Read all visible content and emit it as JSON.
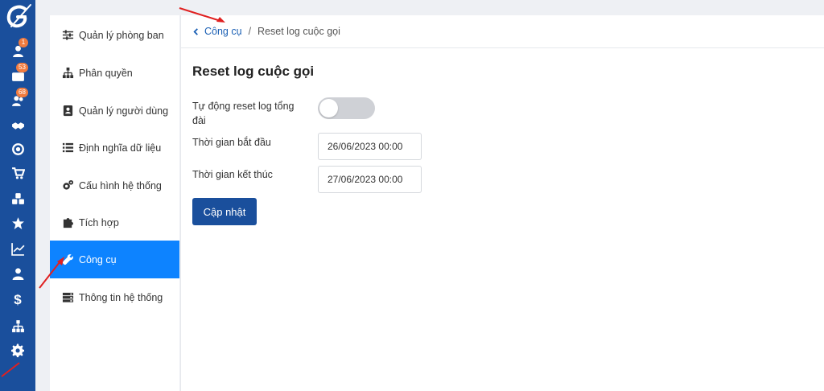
{
  "rail": {
    "items": [
      {
        "icon": "user-icon",
        "badge": "1"
      },
      {
        "icon": "contact-card-icon",
        "badge": "53"
      },
      {
        "icon": "users-icon",
        "badge": "68"
      },
      {
        "icon": "handshake-icon",
        "badge": ""
      },
      {
        "icon": "target-icon",
        "badge": ""
      },
      {
        "icon": "cart-icon",
        "badge": ""
      },
      {
        "icon": "cubes-icon",
        "badge": ""
      },
      {
        "icon": "star-icon",
        "badge": ""
      },
      {
        "icon": "chart-line-icon",
        "badge": ""
      },
      {
        "icon": "user-tie-icon",
        "badge": ""
      },
      {
        "icon": "dollar-icon",
        "badge": ""
      },
      {
        "icon": "sitemap-icon",
        "badge": ""
      },
      {
        "icon": "gear-icon",
        "badge": ""
      }
    ]
  },
  "menu": {
    "items": [
      {
        "label": "Quản lý phòng ban",
        "icon": "sliders-icon"
      },
      {
        "label": "Phân quyền",
        "icon": "sitemap-icon"
      },
      {
        "label": "Quản lý người dùng",
        "icon": "address-book-icon"
      },
      {
        "label": "Định nghĩa dữ liệu",
        "icon": "list-icon"
      },
      {
        "label": "Cấu hình hệ thống",
        "icon": "cogs-icon"
      },
      {
        "label": "Tích hợp",
        "icon": "puzzle-icon"
      },
      {
        "label": "Công cụ",
        "icon": "wrench-icon",
        "active": true
      },
      {
        "label": "Thông tin hệ thống",
        "icon": "server-icon"
      }
    ]
  },
  "breadcrumb": {
    "back_label": "Công cụ",
    "separator": "/",
    "current": "Reset log cuộc gọi"
  },
  "page": {
    "title": "Reset log cuộc gọi",
    "auto_reset_label": "Tự động reset log tổng đài",
    "auto_reset_enabled": false,
    "start_label": "Thời gian bắt đầu",
    "start_value": "26/06/2023 00:00",
    "end_label": "Thời gian kết thúc",
    "end_value": "27/06/2023 00:00",
    "submit_label": "Cập nhật"
  },
  "colors": {
    "rail": "#1a4f9c",
    "active_menu": "#0d83ff",
    "primary_button": "#1a4f9c",
    "badge": "#f07b3f",
    "annotation_arrow": "#e02020"
  }
}
